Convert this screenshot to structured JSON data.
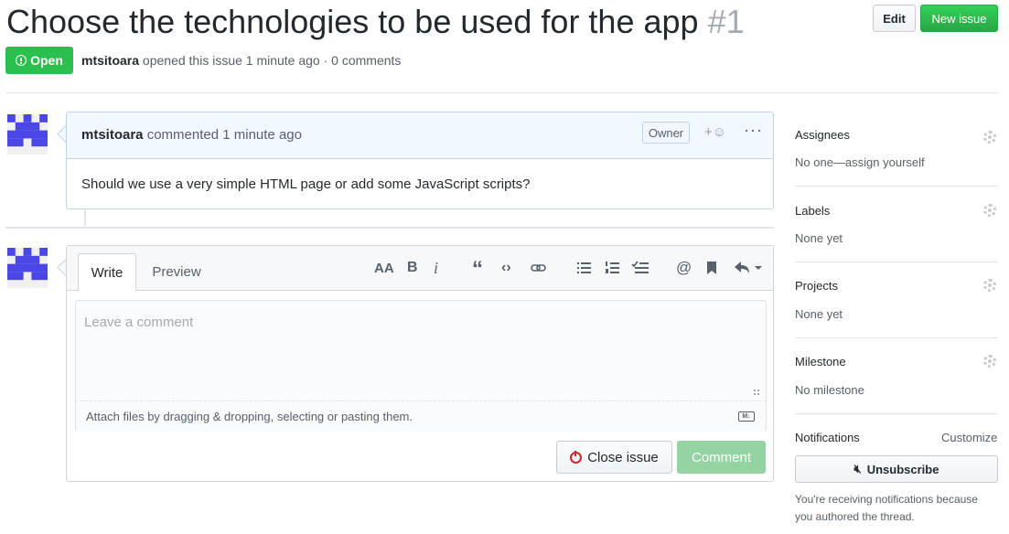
{
  "issue": {
    "title": "Choose the technologies to be used for the app",
    "number": "#1",
    "state": "Open",
    "author": "mtsitoara",
    "meta_text": "opened this issue 1 minute ago · 0 comments"
  },
  "header_buttons": {
    "edit": "Edit",
    "new_issue": "New issue"
  },
  "comment": {
    "author": "mtsitoara",
    "time_text": "commented 1 minute ago",
    "badge": "Owner",
    "reaction": "+☺",
    "more": "···",
    "body": "Should we use a very simple HTML page or add some JavaScript scripts?"
  },
  "editor": {
    "tabs": [
      "Write",
      "Preview"
    ],
    "toolbar": [
      "AA",
      "B",
      "i",
      "“",
      "<>",
      "link",
      "bulleted-list",
      "numbered-list",
      "task-list",
      "@",
      "bookmark",
      "reply"
    ],
    "toolbar_labels": {
      "heading": "AA",
      "bold": "B",
      "italic": "i",
      "quote": "“",
      "code": "‹›",
      "mention": "@"
    },
    "placeholder": "Leave a comment",
    "attach_text": "Attach files by dragging & dropping, selecting or pasting them.",
    "markdown_badge": "M↓",
    "close_button": "Close issue",
    "comment_button": "Comment"
  },
  "sidebar": {
    "sections": [
      {
        "heading": "Assignees",
        "value": "No one—assign yourself"
      },
      {
        "heading": "Labels",
        "value": "None yet"
      },
      {
        "heading": "Projects",
        "value": "None yet"
      },
      {
        "heading": "Milestone",
        "value": "No milestone"
      }
    ],
    "notifications": {
      "heading": "Notifications",
      "customize": "Customize",
      "button": "Unsubscribe",
      "note": "You're receiving notifications because you authored the thread."
    }
  },
  "colors": {
    "open_green": "#2cbe4e",
    "new_issue_green": "#28a745",
    "comment_header_blue": "#f1f8ff",
    "avatar_blue": "#4b47e6",
    "close_red": "#cb2431"
  }
}
